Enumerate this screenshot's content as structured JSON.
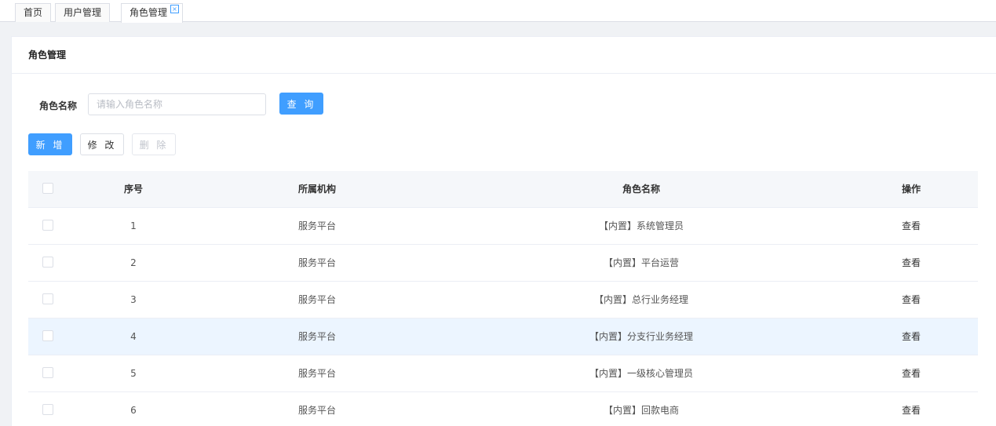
{
  "tabs": [
    {
      "label": "首页"
    },
    {
      "label": "用户管理"
    },
    {
      "label": "角色管理",
      "active": true
    }
  ],
  "tab_close_glyph": "×",
  "card_title": "角色管理",
  "search": {
    "label": "角色名称",
    "placeholder": "请输入角色名称",
    "query_label": "查 询"
  },
  "toolbar": {
    "add_label": "新 增",
    "edit_label": "修 改",
    "delete_label": "删 除"
  },
  "table": {
    "headers": {
      "index": "序号",
      "org": "所属机构",
      "name": "角色名称",
      "op": "操作"
    },
    "rows": [
      {
        "index": "1",
        "org": "服务平台",
        "name": "【内置】系统管理员",
        "op": "查看"
      },
      {
        "index": "2",
        "org": "服务平台",
        "name": "【内置】平台运营",
        "op": "查看"
      },
      {
        "index": "3",
        "org": "服务平台",
        "name": "【内置】总行业务经理",
        "op": "查看"
      },
      {
        "index": "4",
        "org": "服务平台",
        "name": "【内置】分支行业务经理",
        "op": "查看"
      },
      {
        "index": "5",
        "org": "服务平台",
        "name": "【内置】一级核心管理员",
        "op": "查看"
      },
      {
        "index": "6",
        "org": "服务平台",
        "name": "【内置】回款电商",
        "op": "查看"
      }
    ],
    "highlighted_row": "4"
  },
  "colors": {
    "primary": "#409eff",
    "row_highlight": "#ecf5ff",
    "header_bg": "#f5f7fa"
  }
}
